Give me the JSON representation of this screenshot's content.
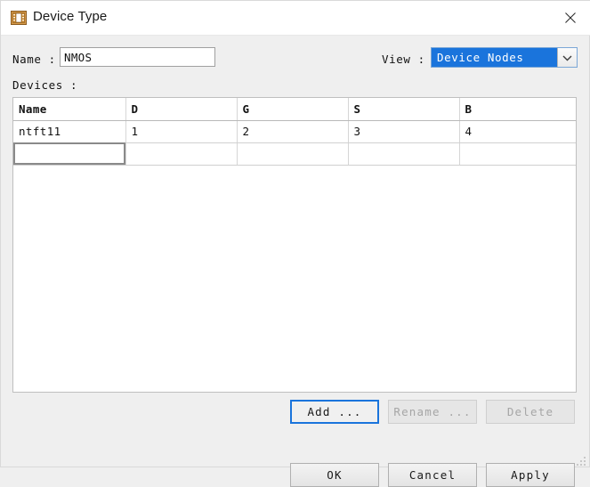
{
  "window": {
    "title": "Device Type",
    "icon": "device-chip-icon",
    "close_icon": "close-icon",
    "resize_grip_icon": "resize-grip-icon"
  },
  "form": {
    "name_label": "Name :",
    "name_value": "NMOS",
    "name_placeholder": "",
    "devices_label": "Devices :",
    "view_label": "View :",
    "view_value": "Device Nodes",
    "view_arrow_icon": "chevron-down-icon"
  },
  "table": {
    "columns": [
      "Name",
      "D",
      "G",
      "S",
      "B"
    ],
    "rows": [
      {
        "name": "ntft11",
        "d": "1",
        "g": "2",
        "s": "3",
        "b": "4"
      },
      {
        "name": "",
        "d": "",
        "g": "",
        "s": "",
        "b": ""
      }
    ]
  },
  "actions": {
    "add_label": "Add ...",
    "rename_label": "Rename ...",
    "delete_label": "Delete"
  },
  "dialog_buttons": {
    "ok_label": "OK",
    "cancel_label": "Cancel",
    "apply_label": "Apply"
  },
  "colors": {
    "accent": "#1a74dc",
    "window_bg": "#efefef",
    "titlebar_bg": "#ffffff",
    "panel_bg": "#ffffff",
    "disabled_text": "#a6a6a6"
  }
}
